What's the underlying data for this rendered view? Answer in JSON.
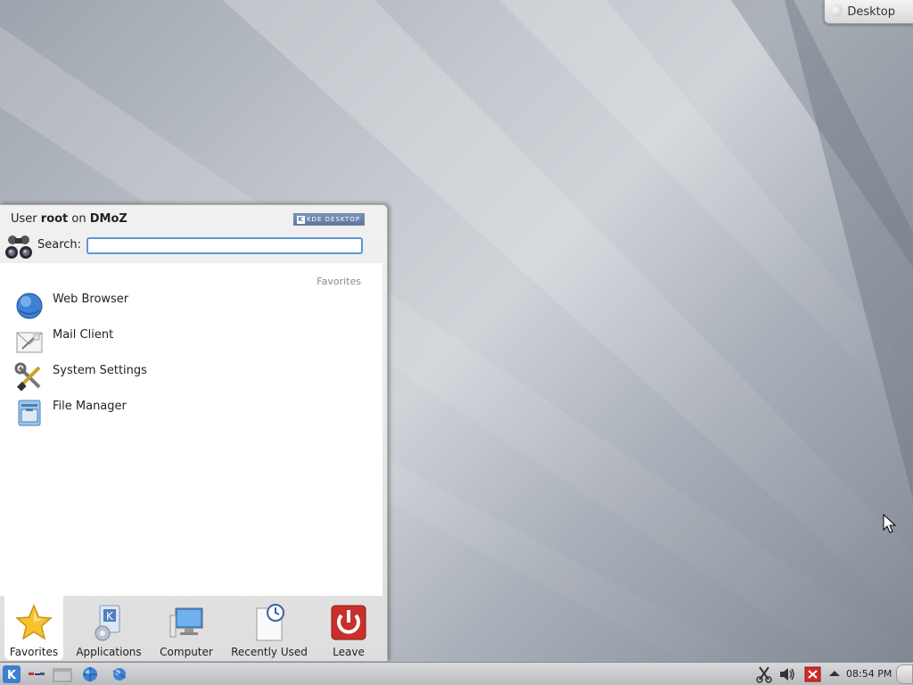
{
  "desktop": {
    "toolbox_label": "Desktop"
  },
  "launcher": {
    "user_prefix": "User",
    "user_name": "root",
    "user_on": "on",
    "host_name": "DMoZ",
    "badge_text": "KDE DESKTOP",
    "search_label": "Search:",
    "search_value": "",
    "favorites_heading": "Favorites",
    "favorites": [
      {
        "label": "Web Browser",
        "icon": "globe-icon"
      },
      {
        "label": "Mail Client",
        "icon": "mail-icon"
      },
      {
        "label": "System Settings",
        "icon": "tools-icon"
      },
      {
        "label": "File Manager",
        "icon": "file-manager-icon"
      }
    ],
    "tabs": [
      {
        "label": "Favorites",
        "icon": "star-icon",
        "active": true
      },
      {
        "label": "Applications",
        "icon": "applications-icon",
        "active": false
      },
      {
        "label": "Computer",
        "icon": "monitor-icon",
        "active": false
      },
      {
        "label": "Recently Used",
        "icon": "clock-document-icon",
        "active": false
      },
      {
        "label": "Leave",
        "icon": "power-icon",
        "active": false
      }
    ]
  },
  "panel": {
    "clock": "08:54 PM",
    "items": [
      {
        "icon": "kde-launcher-icon"
      },
      {
        "icon": "show-desktop-icon"
      },
      {
        "icon": "folder-icon"
      },
      {
        "icon": "web-browser-icon"
      },
      {
        "icon": "network-icon"
      }
    ],
    "tray": [
      {
        "icon": "scissors-icon"
      },
      {
        "icon": "volume-icon"
      },
      {
        "icon": "close-red-icon"
      },
      {
        "icon": "arrow-up-icon"
      }
    ]
  },
  "colors": {
    "accent": "#5b9ad5",
    "kde_blue": "#5d77a0",
    "leave_red": "#c9302c"
  }
}
